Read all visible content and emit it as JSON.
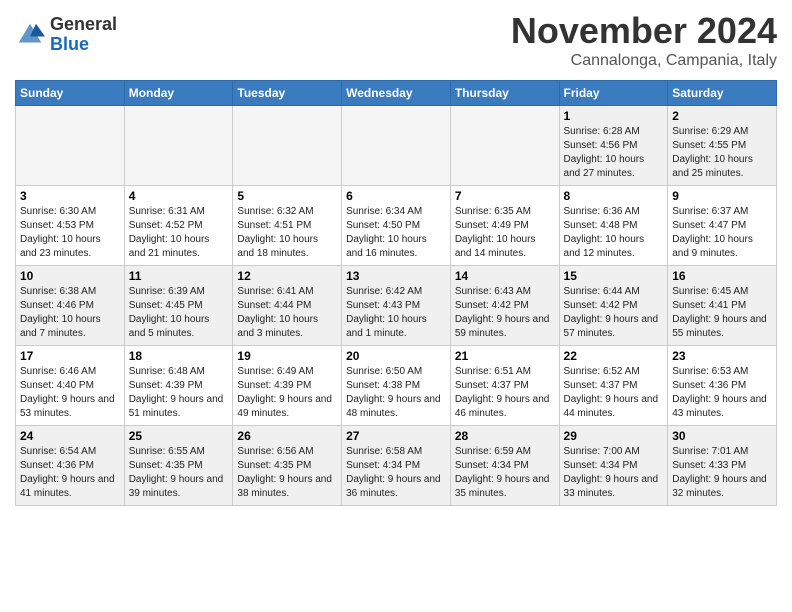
{
  "header": {
    "logo_general": "General",
    "logo_blue": "Blue",
    "month_title": "November 2024",
    "location": "Cannalonga, Campania, Italy"
  },
  "weekdays": [
    "Sunday",
    "Monday",
    "Tuesday",
    "Wednesday",
    "Thursday",
    "Friday",
    "Saturday"
  ],
  "weeks": [
    [
      {
        "day": "",
        "info": ""
      },
      {
        "day": "",
        "info": ""
      },
      {
        "day": "",
        "info": ""
      },
      {
        "day": "",
        "info": ""
      },
      {
        "day": "",
        "info": ""
      },
      {
        "day": "1",
        "info": "Sunrise: 6:28 AM\nSunset: 4:56 PM\nDaylight: 10 hours and 27 minutes."
      },
      {
        "day": "2",
        "info": "Sunrise: 6:29 AM\nSunset: 4:55 PM\nDaylight: 10 hours and 25 minutes."
      }
    ],
    [
      {
        "day": "3",
        "info": "Sunrise: 6:30 AM\nSunset: 4:53 PM\nDaylight: 10 hours and 23 minutes."
      },
      {
        "day": "4",
        "info": "Sunrise: 6:31 AM\nSunset: 4:52 PM\nDaylight: 10 hours and 21 minutes."
      },
      {
        "day": "5",
        "info": "Sunrise: 6:32 AM\nSunset: 4:51 PM\nDaylight: 10 hours and 18 minutes."
      },
      {
        "day": "6",
        "info": "Sunrise: 6:34 AM\nSunset: 4:50 PM\nDaylight: 10 hours and 16 minutes."
      },
      {
        "day": "7",
        "info": "Sunrise: 6:35 AM\nSunset: 4:49 PM\nDaylight: 10 hours and 14 minutes."
      },
      {
        "day": "8",
        "info": "Sunrise: 6:36 AM\nSunset: 4:48 PM\nDaylight: 10 hours and 12 minutes."
      },
      {
        "day": "9",
        "info": "Sunrise: 6:37 AM\nSunset: 4:47 PM\nDaylight: 10 hours and 9 minutes."
      }
    ],
    [
      {
        "day": "10",
        "info": "Sunrise: 6:38 AM\nSunset: 4:46 PM\nDaylight: 10 hours and 7 minutes."
      },
      {
        "day": "11",
        "info": "Sunrise: 6:39 AM\nSunset: 4:45 PM\nDaylight: 10 hours and 5 minutes."
      },
      {
        "day": "12",
        "info": "Sunrise: 6:41 AM\nSunset: 4:44 PM\nDaylight: 10 hours and 3 minutes."
      },
      {
        "day": "13",
        "info": "Sunrise: 6:42 AM\nSunset: 4:43 PM\nDaylight: 10 hours and 1 minute."
      },
      {
        "day": "14",
        "info": "Sunrise: 6:43 AM\nSunset: 4:42 PM\nDaylight: 9 hours and 59 minutes."
      },
      {
        "day": "15",
        "info": "Sunrise: 6:44 AM\nSunset: 4:42 PM\nDaylight: 9 hours and 57 minutes."
      },
      {
        "day": "16",
        "info": "Sunrise: 6:45 AM\nSunset: 4:41 PM\nDaylight: 9 hours and 55 minutes."
      }
    ],
    [
      {
        "day": "17",
        "info": "Sunrise: 6:46 AM\nSunset: 4:40 PM\nDaylight: 9 hours and 53 minutes."
      },
      {
        "day": "18",
        "info": "Sunrise: 6:48 AM\nSunset: 4:39 PM\nDaylight: 9 hours and 51 minutes."
      },
      {
        "day": "19",
        "info": "Sunrise: 6:49 AM\nSunset: 4:39 PM\nDaylight: 9 hours and 49 minutes."
      },
      {
        "day": "20",
        "info": "Sunrise: 6:50 AM\nSunset: 4:38 PM\nDaylight: 9 hours and 48 minutes."
      },
      {
        "day": "21",
        "info": "Sunrise: 6:51 AM\nSunset: 4:37 PM\nDaylight: 9 hours and 46 minutes."
      },
      {
        "day": "22",
        "info": "Sunrise: 6:52 AM\nSunset: 4:37 PM\nDaylight: 9 hours and 44 minutes."
      },
      {
        "day": "23",
        "info": "Sunrise: 6:53 AM\nSunset: 4:36 PM\nDaylight: 9 hours and 43 minutes."
      }
    ],
    [
      {
        "day": "24",
        "info": "Sunrise: 6:54 AM\nSunset: 4:36 PM\nDaylight: 9 hours and 41 minutes."
      },
      {
        "day": "25",
        "info": "Sunrise: 6:55 AM\nSunset: 4:35 PM\nDaylight: 9 hours and 39 minutes."
      },
      {
        "day": "26",
        "info": "Sunrise: 6:56 AM\nSunset: 4:35 PM\nDaylight: 9 hours and 38 minutes."
      },
      {
        "day": "27",
        "info": "Sunrise: 6:58 AM\nSunset: 4:34 PM\nDaylight: 9 hours and 36 minutes."
      },
      {
        "day": "28",
        "info": "Sunrise: 6:59 AM\nSunset: 4:34 PM\nDaylight: 9 hours and 35 minutes."
      },
      {
        "day": "29",
        "info": "Sunrise: 7:00 AM\nSunset: 4:34 PM\nDaylight: 9 hours and 33 minutes."
      },
      {
        "day": "30",
        "info": "Sunrise: 7:01 AM\nSunset: 4:33 PM\nDaylight: 9 hours and 32 minutes."
      }
    ]
  ]
}
